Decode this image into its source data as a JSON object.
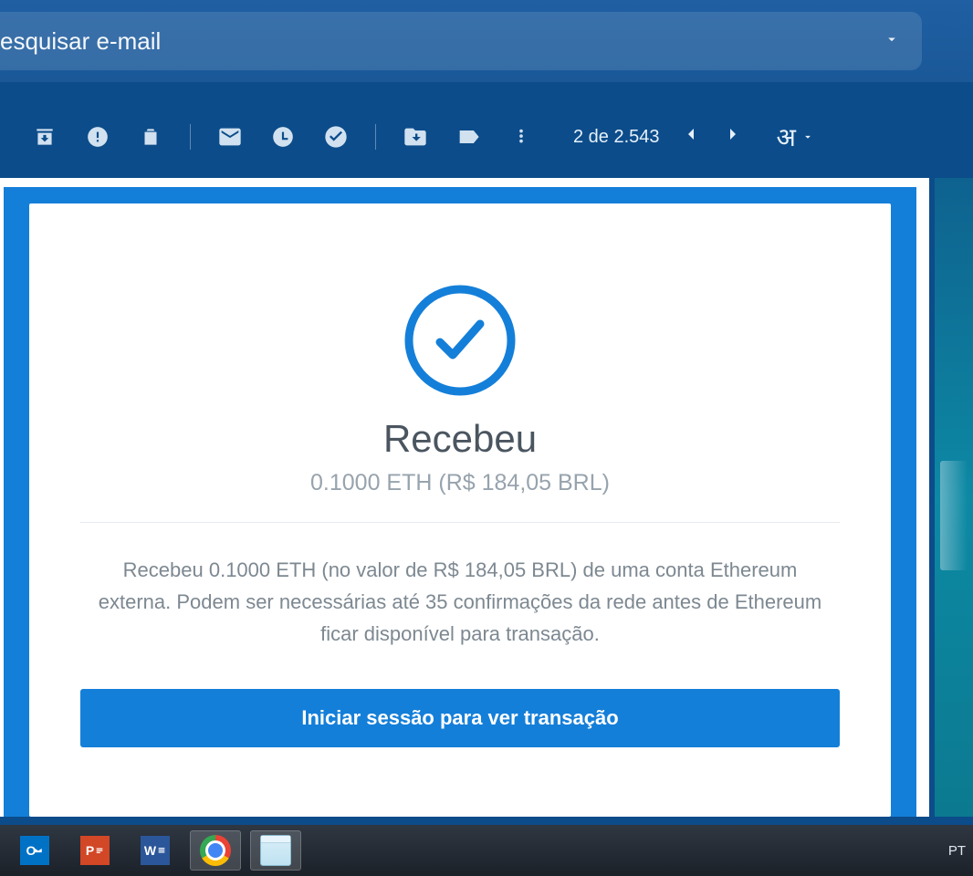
{
  "search": {
    "placeholder": "esquisar e-mail"
  },
  "toolbar": {
    "pager_text": "2 de 2.543",
    "translate_glyph": "अ"
  },
  "email": {
    "title": "Recebeu",
    "subtitle": "0.1000 ETH (R$ 184,05 BRL)",
    "description": "Recebeu 0.1000 ETH (no valor de R$ 184,05 BRL) de uma conta Ethereum externa. Podem ser necessárias até 35 confirmações da rede antes de Ethereum ficar disponível para transação.",
    "cta": "Iniciar sessão para ver transação"
  },
  "taskbar": {
    "outlook_label": "O",
    "powerpoint_label": "P",
    "word_label": "W",
    "lang": "PT"
  }
}
